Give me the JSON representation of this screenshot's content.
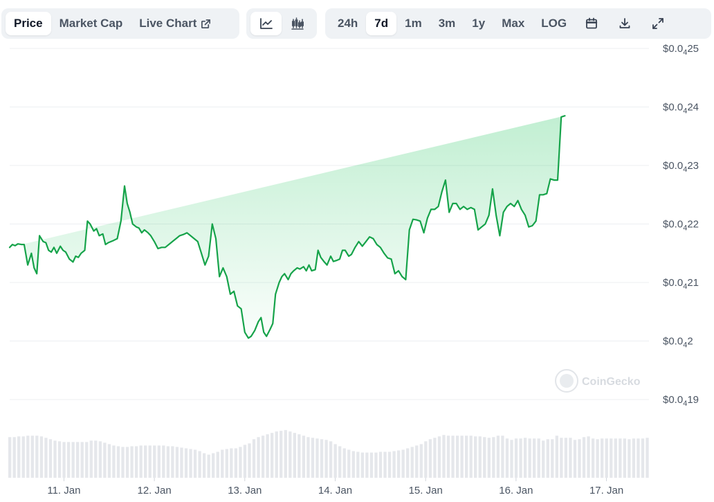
{
  "toolbar": {
    "view_tabs": [
      {
        "label": "Price",
        "active": true
      },
      {
        "label": "Market Cap",
        "active": false
      },
      {
        "label": "Live Chart",
        "active": false,
        "icon": "external-link-icon"
      }
    ],
    "chart_style_icons": [
      {
        "icon": "line-chart-icon",
        "active": true
      },
      {
        "icon": "candlestick-icon",
        "active": false
      }
    ],
    "ranges": [
      {
        "label": "24h",
        "active": false
      },
      {
        "label": "7d",
        "active": true
      },
      {
        "label": "1m",
        "active": false
      },
      {
        "label": "3m",
        "active": false
      },
      {
        "label": "1y",
        "active": false
      },
      {
        "label": "Max",
        "active": false
      },
      {
        "label": "LOG",
        "active": false
      }
    ],
    "action_icons": [
      "calendar-icon",
      "download-icon",
      "fullscreen-icon"
    ]
  },
  "watermark": "CoinGecko",
  "colors": {
    "line": "#16a34a",
    "fill": "#dcfce7",
    "grid": "#eceff2",
    "volume": "#e5e7eb",
    "tab_bg": "#eff2f5"
  },
  "chart_data": {
    "type": "line",
    "y_unit_note": "price in $0.0(4 zeros) notation",
    "y_ticks": [
      {
        "prefix": "$0.0",
        "sub": "4",
        "rest": "19",
        "value": 1.9e-05
      },
      {
        "prefix": "$0.0",
        "sub": "4",
        "rest": "2",
        "value": 2e-05
      },
      {
        "prefix": "$0.0",
        "sub": "4",
        "rest": "21",
        "value": 2.1e-05
      },
      {
        "prefix": "$0.0",
        "sub": "4",
        "rest": "22",
        "value": 2.2e-05
      },
      {
        "prefix": "$0.0",
        "sub": "4",
        "rest": "23",
        "value": 2.3e-05
      },
      {
        "prefix": "$0.0",
        "sub": "4",
        "rest": "24",
        "value": 2.4e-05
      },
      {
        "prefix": "$0.0",
        "sub": "4",
        "rest": "25",
        "value": 2.5e-05
      }
    ],
    "ylim": [
      1.9e-05,
      2.5e-05
    ],
    "x_ticks": [
      {
        "label": "11. Jan",
        "day": 11
      },
      {
        "label": "12. Jan",
        "day": 12
      },
      {
        "label": "13. Jan",
        "day": 13
      },
      {
        "label": "14. Jan",
        "day": 14
      },
      {
        "label": "15. Jan",
        "day": 15
      },
      {
        "label": "16. Jan",
        "day": 16
      },
      {
        "label": "17. Jan",
        "day": 17
      }
    ],
    "xlim_days": [
      10.4,
      17.47
    ],
    "grid": true,
    "series": [
      {
        "days": [
          10.4,
          10.43,
          10.46,
          10.49,
          10.53,
          10.56,
          10.6,
          10.64,
          10.67,
          10.7,
          10.73,
          10.77,
          10.8,
          10.83,
          10.86,
          10.89,
          10.92,
          10.96,
          10.99,
          11.02,
          11.06,
          11.1,
          11.13,
          11.16,
          11.19,
          11.23,
          11.26,
          11.29,
          11.33,
          11.36,
          11.39,
          11.43,
          11.46,
          11.49,
          11.52,
          11.55,
          11.59,
          11.63,
          11.67,
          11.7,
          11.73,
          11.76,
          11.8,
          11.83,
          11.86,
          11.89,
          11.93,
          11.96,
          12.0,
          12.04,
          12.08,
          12.12,
          12.16,
          12.2,
          12.24,
          12.28,
          12.32,
          12.36,
          12.4,
          12.44,
          12.48,
          12.52,
          12.56,
          12.6,
          12.64,
          12.68,
          12.72,
          12.76,
          12.8,
          12.84,
          12.88,
          12.92,
          12.96,
          13.0,
          13.04,
          13.07,
          13.11,
          13.15,
          13.18,
          13.21,
          13.24,
          13.28,
          13.31,
          13.34,
          13.38,
          13.41,
          13.44,
          13.48,
          13.51,
          13.54,
          13.58,
          13.61,
          13.65,
          13.68,
          13.71,
          13.74,
          13.78,
          13.81,
          13.84,
          13.88,
          13.91,
          13.95,
          13.98,
          14.02,
          14.05,
          14.08,
          14.11,
          14.15,
          14.18,
          14.22,
          14.26,
          14.3,
          14.34,
          14.38,
          14.42,
          14.46,
          14.5,
          14.54,
          14.58,
          14.62,
          14.66,
          14.7,
          14.74,
          14.78,
          14.82,
          14.86,
          14.9,
          14.94,
          14.98,
          15.02,
          15.06,
          15.1,
          15.14,
          15.18,
          15.22,
          15.26,
          15.3,
          15.34,
          15.38,
          15.42,
          15.46,
          15.5,
          15.54,
          15.58,
          15.62,
          15.66,
          15.7,
          15.74,
          15.78,
          15.82,
          15.86,
          15.9,
          15.94,
          15.98,
          16.02,
          16.06,
          16.1,
          16.14,
          16.18,
          16.22,
          16.26,
          16.3,
          16.34,
          16.38,
          16.42,
          16.46,
          16.5,
          16.54,
          16.58,
          16.62,
          16.66,
          16.7,
          16.74,
          16.78,
          16.82,
          16.86,
          16.9,
          16.94,
          16.98,
          17.02,
          17.06,
          17.1,
          17.14,
          17.18,
          17.22,
          17.26,
          17.3,
          17.34,
          17.38,
          17.42,
          17.45,
          17.47
        ],
        "values": [
          2.16e-05,
          2.165e-05,
          2.163e-05,
          2.166e-05,
          2.165e-05,
          2.165e-05,
          2.13e-05,
          2.15e-05,
          2.125e-05,
          2.115e-05,
          2.18e-05,
          2.17e-05,
          2.168e-05,
          2.155e-05,
          2.152e-05,
          2.16e-05,
          2.15e-05,
          2.162e-05,
          2.155e-05,
          2.152e-05,
          2.14e-05,
          2.135e-05,
          2.145e-05,
          2.143e-05,
          2.15e-05,
          2.155e-05,
          2.205e-05,
          2.2e-05,
          2.188e-05,
          2.192e-05,
          2.18e-05,
          2.183e-05,
          2.165e-05,
          2.168e-05,
          2.17e-05,
          2.172e-05,
          2.175e-05,
          2.205e-05,
          2.265e-05,
          2.235e-05,
          2.22e-05,
          2.2e-05,
          2.195e-05,
          2.193e-05,
          2.185e-05,
          2.19e-05,
          2.185e-05,
          2.18e-05,
          2.17e-05,
          2.158e-05,
          2.16e-05,
          2.16e-05,
          2.165e-05,
          2.17e-05,
          2.175e-05,
          2.18e-05,
          2.182e-05,
          2.185e-05,
          2.18e-05,
          2.175e-05,
          2.17e-05,
          2.15e-05,
          2.13e-05,
          2.145e-05,
          2.2e-05,
          2.175e-05,
          2.11e-05,
          2.125e-05,
          2.11e-05,
          2.08e-05,
          2.085e-05,
          2.06e-05,
          2.055e-05,
          2.015e-05,
          2.005e-05,
          2.008e-05,
          2.018e-05,
          2.033e-05,
          2.04e-05,
          2.015e-05,
          2.008e-05,
          2.02e-05,
          2.03e-05,
          2.08e-05,
          2.1e-05,
          2.11e-05,
          2.115e-05,
          2.105e-05,
          2.115e-05,
          2.12e-05,
          2.125e-05,
          2.123e-05,
          2.127e-05,
          2.12e-05,
          2.13e-05,
          2.12e-05,
          2.122e-05,
          2.155e-05,
          2.143e-05,
          2.135e-05,
          2.13e-05,
          2.145e-05,
          2.136e-05,
          2.138e-05,
          2.14e-05,
          2.155e-05,
          2.155e-05,
          2.145e-05,
          2.148e-05,
          2.16e-05,
          2.17e-05,
          2.162e-05,
          2.17e-05,
          2.178e-05,
          2.175e-05,
          2.165e-05,
          2.16e-05,
          2.15e-05,
          2.142e-05,
          2.14e-05,
          2.115e-05,
          2.12e-05,
          2.11e-05,
          2.105e-05,
          2.19e-05,
          2.208e-05,
          2.207e-05,
          2.205e-05,
          2.185e-05,
          2.21e-05,
          2.225e-05,
          2.225e-05,
          2.23e-05,
          2.255e-05,
          2.275e-05,
          2.22e-05,
          2.235e-05,
          2.235e-05,
          2.225e-05,
          2.23e-05,
          2.225e-05,
          2.228e-05,
          2.225e-05,
          2.19e-05,
          2.195e-05,
          2.2e-05,
          2.215e-05,
          2.26e-05,
          2.215e-05,
          2.18e-05,
          2.22e-05,
          2.23e-05,
          2.235e-05,
          2.23e-05,
          2.24e-05,
          2.225e-05,
          2.215e-05,
          2.195e-05,
          2.197e-05,
          2.205e-05,
          2.25e-05,
          2.25e-05,
          2.252e-05,
          2.277e-05,
          2.275e-05,
          2.275e-05,
          2.383e-05,
          2.385e-05
        ]
      }
    ],
    "volume": {
      "days": [
        10.4,
        10.45,
        10.5,
        10.55,
        10.6,
        10.65,
        10.7,
        10.75,
        10.8,
        10.85,
        10.9,
        10.95,
        11.0,
        11.05,
        11.1,
        11.15,
        11.2,
        11.25,
        11.3,
        11.35,
        11.4,
        11.45,
        11.5,
        11.55,
        11.6,
        11.65,
        11.7,
        11.75,
        11.8,
        11.85,
        11.9,
        11.95,
        12.0,
        12.05,
        12.1,
        12.15,
        12.2,
        12.25,
        12.3,
        12.35,
        12.4,
        12.45,
        12.5,
        12.55,
        12.6,
        12.65,
        12.7,
        12.75,
        12.8,
        12.85,
        12.9,
        12.95,
        13.0,
        13.05,
        13.1,
        13.15,
        13.2,
        13.25,
        13.3,
        13.35,
        13.4,
        13.45,
        13.5,
        13.55,
        13.6,
        13.65,
        13.7,
        13.75,
        13.8,
        13.85,
        13.9,
        13.95,
        14.0,
        14.05,
        14.1,
        14.15,
        14.2,
        14.25,
        14.3,
        14.35,
        14.4,
        14.45,
        14.5,
        14.55,
        14.6,
        14.65,
        14.7,
        14.75,
        14.8,
        14.85,
        14.9,
        14.95,
        15.0,
        15.05,
        15.1,
        15.15,
        15.2,
        15.25,
        15.3,
        15.35,
        15.4,
        15.45,
        15.5,
        15.55,
        15.6,
        15.65,
        15.7,
        15.75,
        15.8,
        15.85,
        15.9,
        15.95,
        16.0,
        16.05,
        16.1,
        16.15,
        16.2,
        16.25,
        16.3,
        16.35,
        16.4,
        16.45,
        16.5,
        16.55,
        16.6,
        16.65,
        16.7,
        16.75,
        16.8,
        16.85,
        16.9,
        16.95,
        17.0,
        17.05,
        17.1,
        17.15,
        17.2,
        17.25,
        17.3,
        17.35,
        17.4,
        17.45
      ],
      "values": [
        58,
        58,
        59,
        59,
        60,
        60,
        60,
        59,
        57,
        55,
        53,
        52,
        51,
        51,
        51,
        51,
        51,
        51,
        53,
        53,
        52,
        50,
        48,
        46,
        45,
        44,
        44,
        45,
        45,
        46,
        46,
        46,
        46,
        46,
        46,
        45,
        45,
        44,
        43,
        42,
        41,
        40,
        38,
        35,
        33,
        35,
        37,
        40,
        41,
        42,
        42,
        44,
        47,
        49,
        55,
        58,
        60,
        62,
        64,
        66,
        67,
        68,
        66,
        64,
        62,
        60,
        58,
        57,
        56,
        55,
        54,
        52,
        48,
        45,
        42,
        40,
        38,
        37,
        36,
        36,
        36,
        36,
        37,
        37,
        37,
        38,
        39,
        40,
        42,
        44,
        46,
        48,
        52,
        55,
        57,
        59,
        61,
        60,
        60,
        60,
        60,
        60,
        60,
        59,
        59,
        58,
        57,
        58,
        60,
        60,
        56,
        54,
        56,
        56,
        57,
        56,
        56,
        56,
        53,
        55,
        55,
        60,
        57,
        57,
        57,
        54,
        55,
        58,
        59,
        56,
        55,
        56,
        56,
        56,
        56,
        56,
        56,
        55,
        56,
        56,
        56,
        57,
        60,
        79
      ]
    }
  }
}
